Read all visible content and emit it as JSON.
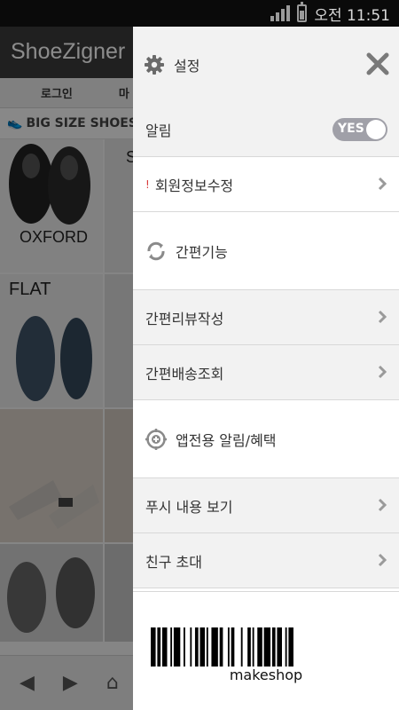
{
  "status_bar": {
    "time": "오전 11:51"
  },
  "background_app": {
    "logo": "ShoeZigner",
    "nav": [
      "로그인",
      "마"
    ],
    "category": "BIG SIZE SHOES",
    "tiles": [
      "OXFORD",
      "FLAT",
      "S"
    ]
  },
  "drawer": {
    "settings_title": "설정",
    "items": {
      "alarm": {
        "label": "알림",
        "toggle": "YES"
      },
      "member_edit": {
        "label": "회원정보수정",
        "mark": "!"
      },
      "quick_section": {
        "label": "간편기능"
      },
      "quick_review": {
        "label": "간편리뷰작성"
      },
      "quick_delivery": {
        "label": "간편배송조회"
      },
      "app_section": {
        "label": "앱전용 알림/혜택"
      },
      "push_view": {
        "label": "푸시 내용 보기"
      },
      "invite": {
        "label": "친구 초대"
      }
    },
    "barcode_text": "makeshop"
  },
  "colors": {
    "toggle_bg": "#a0a0a8",
    "drawer_bg": "#ffffff",
    "row_gray": "#f2f2f2",
    "alert": "#d83a3a"
  },
  "icons": [
    "gear-icon",
    "close-icon",
    "chevron-right-icon",
    "sync-icon",
    "target-plus-icon",
    "barcode-image"
  ]
}
